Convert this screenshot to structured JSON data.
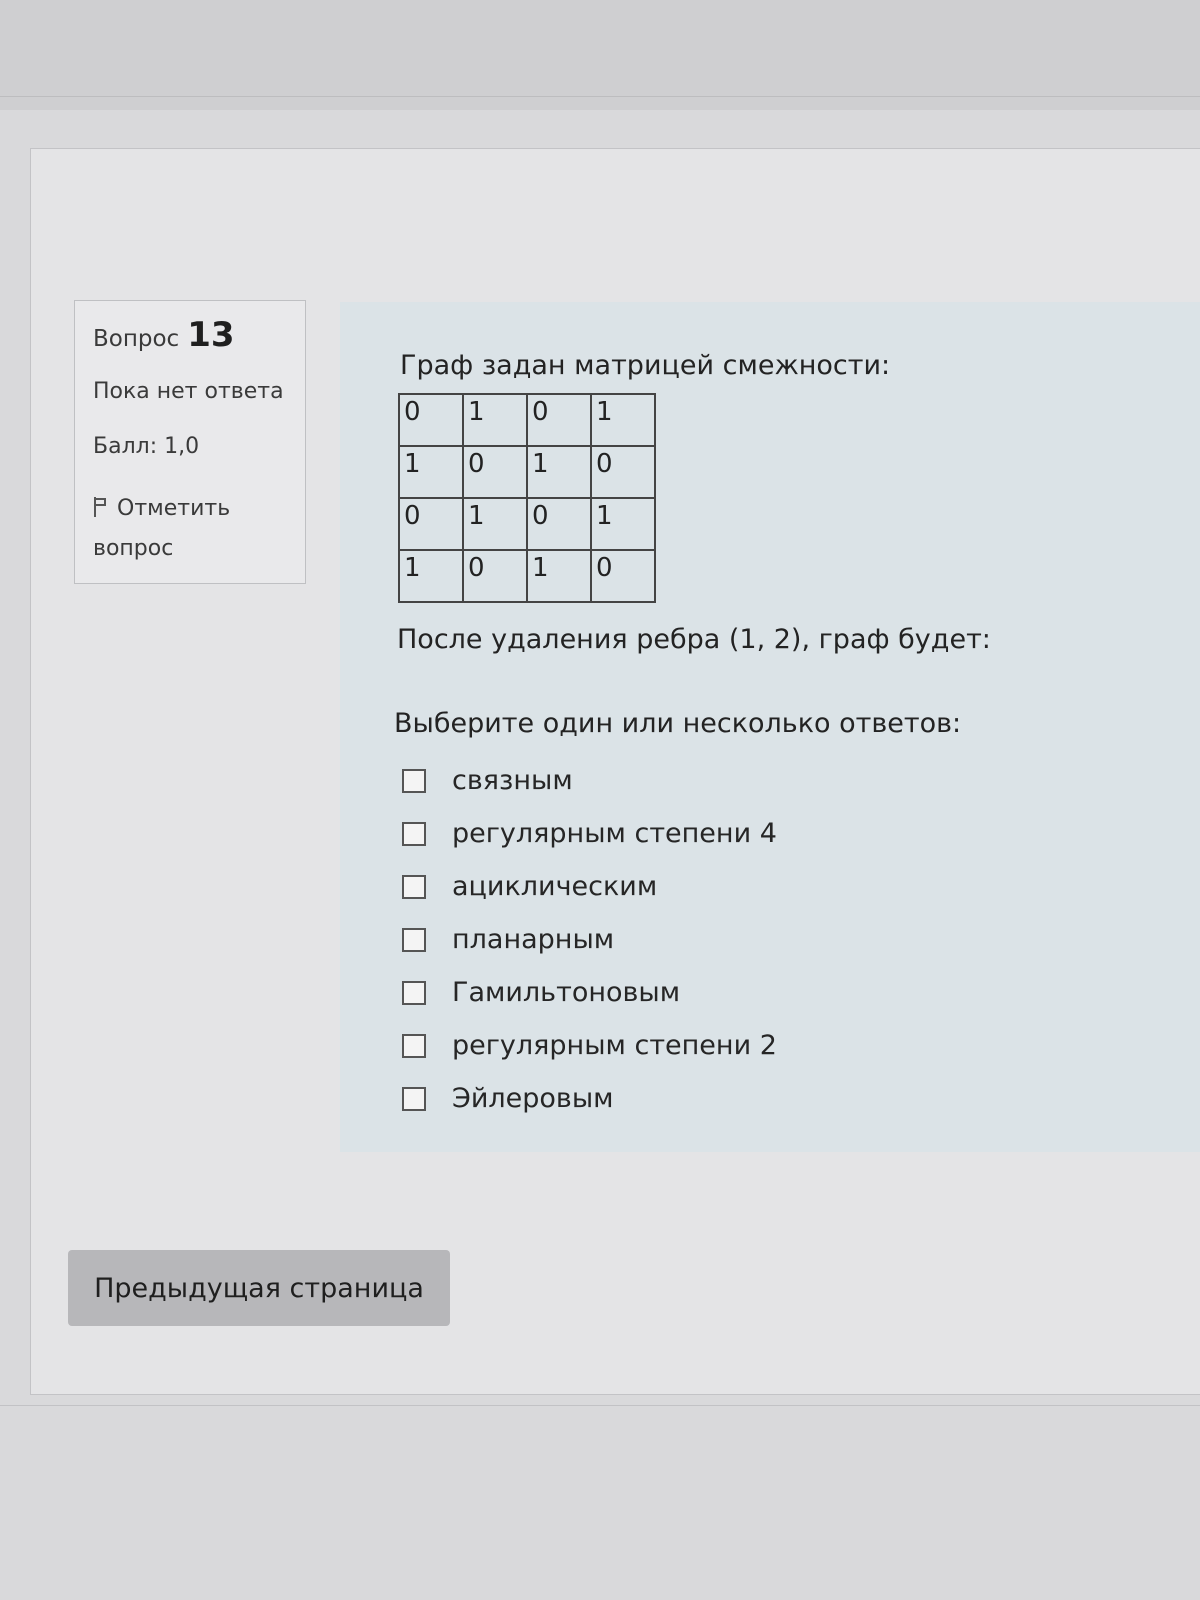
{
  "question": {
    "label": "Вопрос",
    "number": "13",
    "state": "Пока нет ответа",
    "grade": "Балл: 1,0",
    "flag_label": "Отметить вопрос",
    "flag_icon": "flag-icon"
  },
  "content": {
    "intro": "Граф задан матрицей смежности:",
    "matrix": [
      [
        "0",
        "1",
        "0",
        "1"
      ],
      [
        "1",
        "0",
        "1",
        "0"
      ],
      [
        "0",
        "1",
        "0",
        "1"
      ],
      [
        "1",
        "0",
        "1",
        "0"
      ]
    ],
    "after_matrix": "После удаления ребра (1, 2), граф будет:",
    "prompt": "Выберите один или несколько ответов:",
    "options": [
      "связным",
      "регулярным степени 4",
      "ациклическим",
      "планарным",
      "Гамильтоновым",
      "регулярным степени 2",
      "Эйлеровым"
    ]
  },
  "navigation": {
    "prev_label": "Предыдущая страница"
  }
}
